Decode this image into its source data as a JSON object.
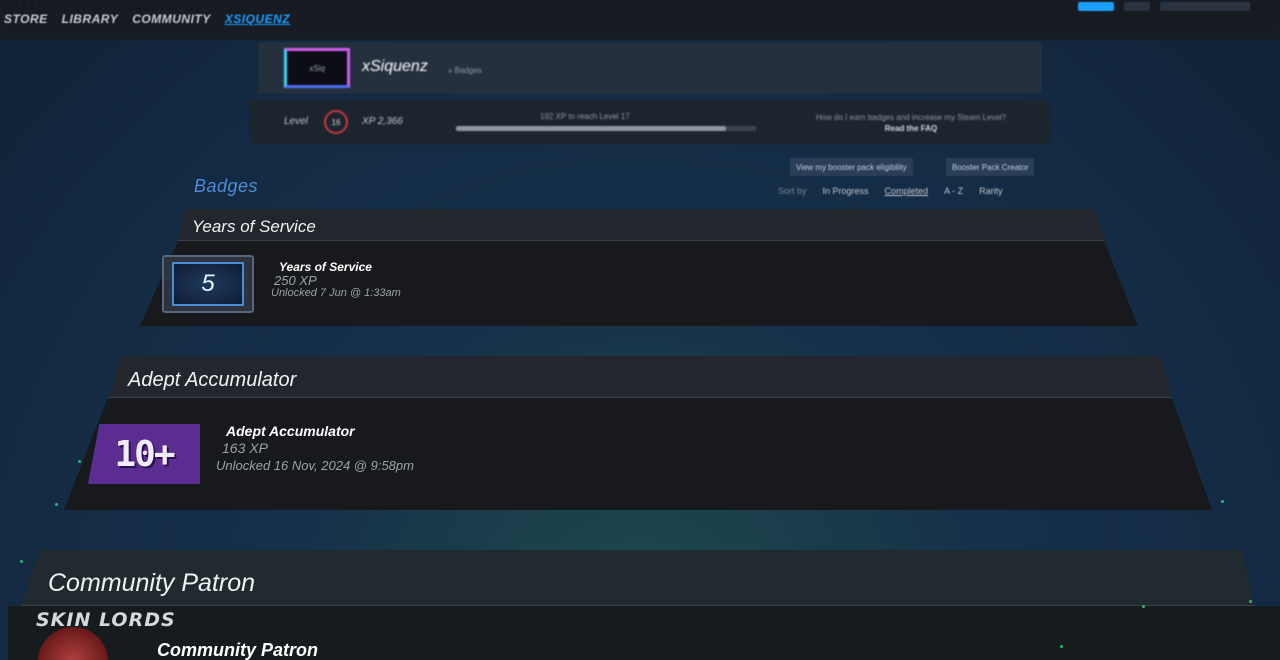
{
  "nav": {
    "items": [
      "STORE",
      "LIBRARY",
      "COMMUNITY"
    ],
    "active": "XSIQUENZ"
  },
  "profile": {
    "name": "xSiquenz",
    "section": "» Badges",
    "avatar_text": "xSiq"
  },
  "level": {
    "label": "Level",
    "value": "16",
    "xp_label": "XP 2,366",
    "next": "192 XP to reach Level 17",
    "progress": 0.9,
    "howto_text": "How do I earn badges and increase my Steam Level?",
    "howto_link": "Read the FAQ"
  },
  "buttons": {
    "booster": "View my booster pack eligibility",
    "creator": "Booster Pack Creator"
  },
  "badges_title": "Badges",
  "sort": {
    "label": "Sort by",
    "options": [
      "In Progress",
      "Completed",
      "A - Z",
      "Rarity"
    ],
    "selected": "Completed"
  },
  "badges": [
    {
      "title": "Years of Service",
      "name": "Years of Service",
      "icon_text": "5",
      "xp": "250 XP",
      "unlocked": "Unlocked 7 Jun @ 1:33am"
    },
    {
      "title": "Adept Accumulator",
      "name": "Adept Accumulator",
      "icon_text": "10+",
      "xp": "163 XP",
      "unlocked": "Unlocked 16 Nov, 2024 @ 9:58pm"
    },
    {
      "title": "Community Patron",
      "name": "Community Patron"
    }
  ],
  "watermark": "SKIN LORDS",
  "colors": {
    "accent": "#1a9fff",
    "badges_title": "#4f8bd6",
    "adept_icon": "#5b2d91"
  }
}
